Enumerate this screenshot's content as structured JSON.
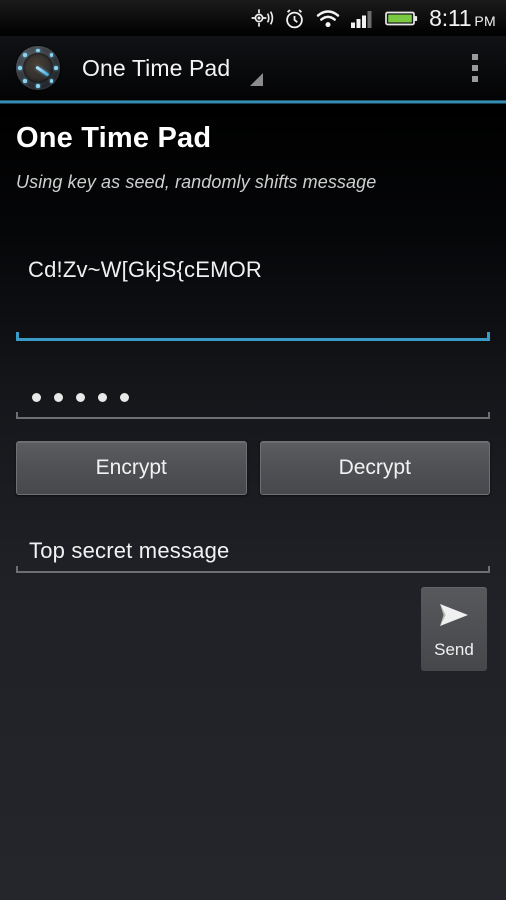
{
  "status_bar": {
    "time": "8:11",
    "ampm": "PM",
    "icons": [
      {
        "name": "gps-location-icon"
      },
      {
        "name": "alarm-clock-icon"
      },
      {
        "name": "wifi-icon"
      },
      {
        "name": "cellular-signal-icon"
      },
      {
        "name": "battery-icon"
      }
    ],
    "battery_color": "#7ac943"
  },
  "action_bar": {
    "app_icon_name": "gauge-dial-app-icon",
    "title": "One Time Pad",
    "overflow_label": "More options",
    "accent_color": "#3f9dc4"
  },
  "screen": {
    "title": "One Time Pad",
    "subtitle": "Using key as seed, randomly shifts message"
  },
  "cipher": {
    "output_text": "Cd!Zv~W[GkjS{cEMOR"
  },
  "fields": {
    "cipher_input": {
      "value": "",
      "placeholder": "",
      "focused": true
    },
    "key_input": {
      "value": "•  •  •  •  •",
      "masked_char_count": 5,
      "placeholder": "",
      "focused": false
    },
    "message_input": {
      "value": "Top secret message",
      "placeholder": "",
      "focused": false
    }
  },
  "buttons": {
    "encrypt_label": "Encrypt",
    "decrypt_label": "Decrypt",
    "send_label": "Send",
    "send_icon_name": "paper-plane-send-icon"
  }
}
